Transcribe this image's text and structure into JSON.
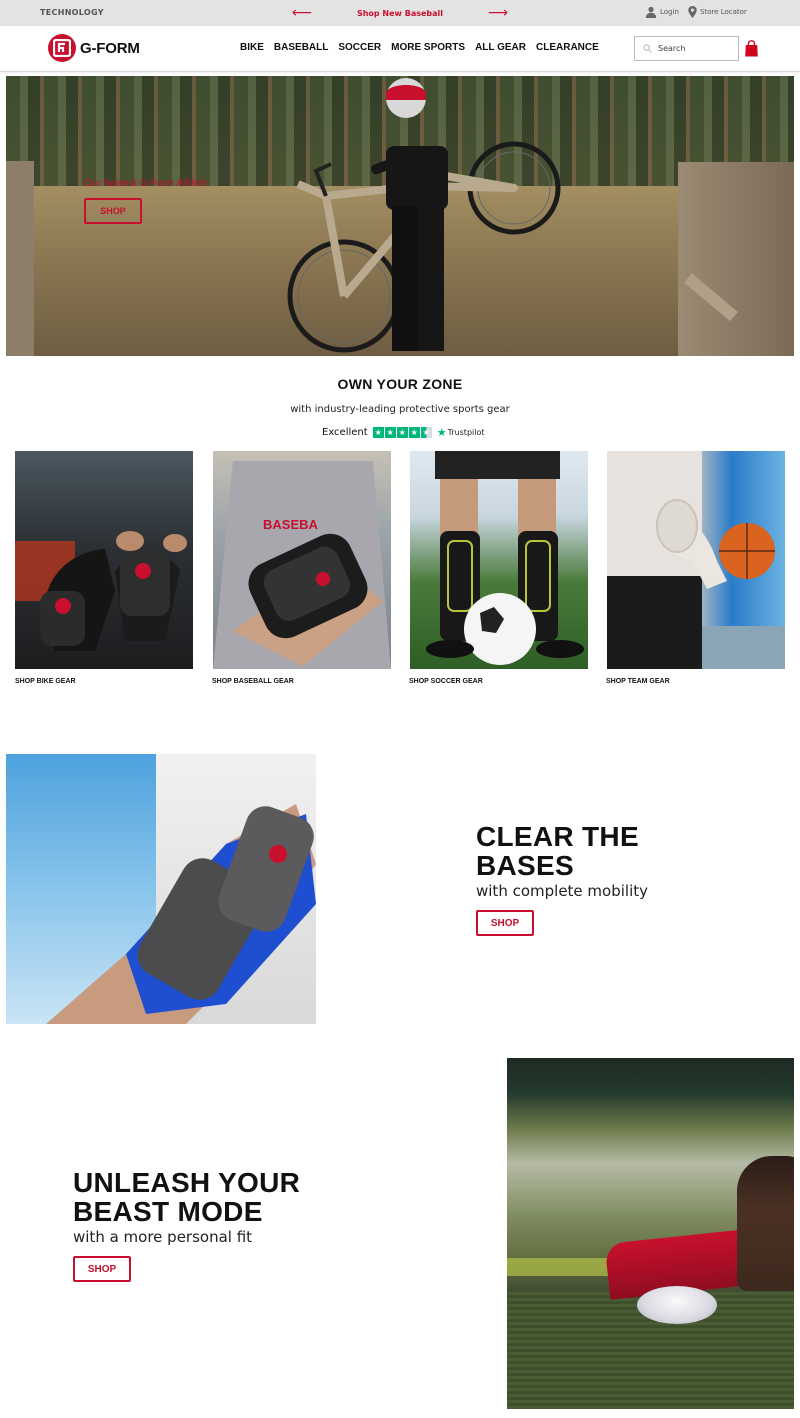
{
  "topbar": {
    "technology": "TECHNOLOGY",
    "promo_text": "Shop New Baseball",
    "prev_arrow": "⟵",
    "next_arrow": "⟶",
    "login": "Login",
    "store_locator": "Store Locator"
  },
  "header": {
    "logo_text": "G-FORM",
    "nav": [
      "BIKE",
      "BASEBALL",
      "SOCCER",
      "MORE SPORTS",
      "ALL GEAR",
      "CLEARANCE"
    ],
    "search_placeholder": "Search"
  },
  "hero": {
    "tag": "Our Newest G-Form Athlete",
    "button": "SHOP"
  },
  "zone": {
    "title": "OWN YOUR ZONE",
    "subtitle": "with industry-leading protective sports gear",
    "rating_label": "Excellent",
    "trustpilot": "Trustpilot",
    "star_rating": 4.5
  },
  "tiles": [
    {
      "label": "SHOP BIKE GEAR"
    },
    {
      "label": "SHOP BASEBALL GEAR"
    },
    {
      "label": "SHOP SOCCER GEAR"
    },
    {
      "label": "SHOP TEAM GEAR"
    }
  ],
  "clear_bases": {
    "title_line1": "CLEAR THE",
    "title_line2": "BASES",
    "subtitle": "with complete mobility",
    "button": "SHOP"
  },
  "unleash": {
    "title_line1": "UNLEASH YOUR",
    "title_line2": "BEAST MODE",
    "subtitle": "with a more personal fit",
    "button": "SHOP"
  },
  "colors": {
    "brand_red": "#c8102e",
    "trustpilot_green": "#00b67a",
    "topbar_bg": "#e3e3e3"
  }
}
